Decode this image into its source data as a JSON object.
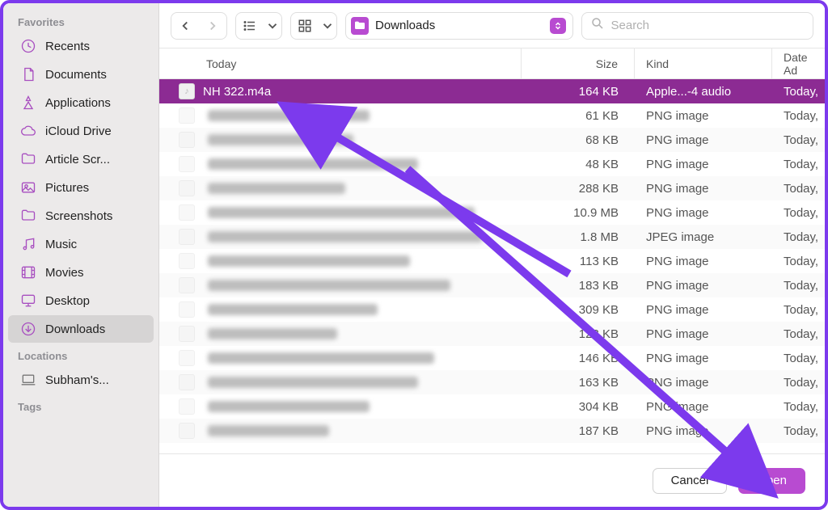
{
  "sidebar": {
    "favorites_label": "Favorites",
    "locations_label": "Locations",
    "tags_label": "Tags",
    "items": [
      {
        "label": "Recents",
        "icon": "clock-icon"
      },
      {
        "label": "Documents",
        "icon": "doc-icon"
      },
      {
        "label": "Applications",
        "icon": "apps-icon"
      },
      {
        "label": "iCloud Drive",
        "icon": "cloud-icon"
      },
      {
        "label": "Article Scr...",
        "icon": "folder-icon"
      },
      {
        "label": "Pictures",
        "icon": "image-icon"
      },
      {
        "label": "Screenshots",
        "icon": "folder-icon"
      },
      {
        "label": "Music",
        "icon": "music-icon"
      },
      {
        "label": "Movies",
        "icon": "film-icon"
      },
      {
        "label": "Desktop",
        "icon": "desktop-icon"
      },
      {
        "label": "Downloads",
        "icon": "download-icon",
        "selected": true
      }
    ],
    "locations": [
      {
        "label": "Subham's...",
        "icon": "laptop-icon"
      }
    ]
  },
  "toolbar": {
    "location": "Downloads",
    "search_placeholder": "Search"
  },
  "columns": {
    "name": "Today",
    "size": "Size",
    "kind": "Kind",
    "date": "Date Ad"
  },
  "files": [
    {
      "name": "NH 322.m4a",
      "size": "164 KB",
      "kind": "Apple...-4 audio",
      "date": "Today,",
      "selected": true
    },
    {
      "name": "",
      "size": "61 KB",
      "kind": "PNG image",
      "date": "Today,"
    },
    {
      "name": "",
      "size": "68 KB",
      "kind": "PNG image",
      "date": "Today,"
    },
    {
      "name": "",
      "size": "48 KB",
      "kind": "PNG image",
      "date": "Today,"
    },
    {
      "name": "",
      "size": "288 KB",
      "kind": "PNG image",
      "date": "Today,"
    },
    {
      "name": "",
      "size": "10.9 MB",
      "kind": "PNG image",
      "date": "Today,"
    },
    {
      "name": "",
      "size": "1.8 MB",
      "kind": "JPEG image",
      "date": "Today,"
    },
    {
      "name": "",
      "size": "113 KB",
      "kind": "PNG image",
      "date": "Today,"
    },
    {
      "name": "",
      "size": "183 KB",
      "kind": "PNG image",
      "date": "Today,"
    },
    {
      "name": "",
      "size": "309 KB",
      "kind": "PNG image",
      "date": "Today,"
    },
    {
      "name": "",
      "size": "123 KB",
      "kind": "PNG image",
      "date": "Today,"
    },
    {
      "name": "",
      "size": "146 KB",
      "kind": "PNG image",
      "date": "Today,"
    },
    {
      "name": "",
      "size": "163 KB",
      "kind": "PNG image",
      "date": "Today,"
    },
    {
      "name": "",
      "size": "304 KB",
      "kind": "PNG image",
      "date": "Today,"
    },
    {
      "name": "",
      "size": "187 KB",
      "kind": "PNG image",
      "date": "Today,"
    }
  ],
  "footer": {
    "cancel": "Cancel",
    "open": "Open"
  },
  "annotation": {
    "color": "#7c3aed"
  }
}
